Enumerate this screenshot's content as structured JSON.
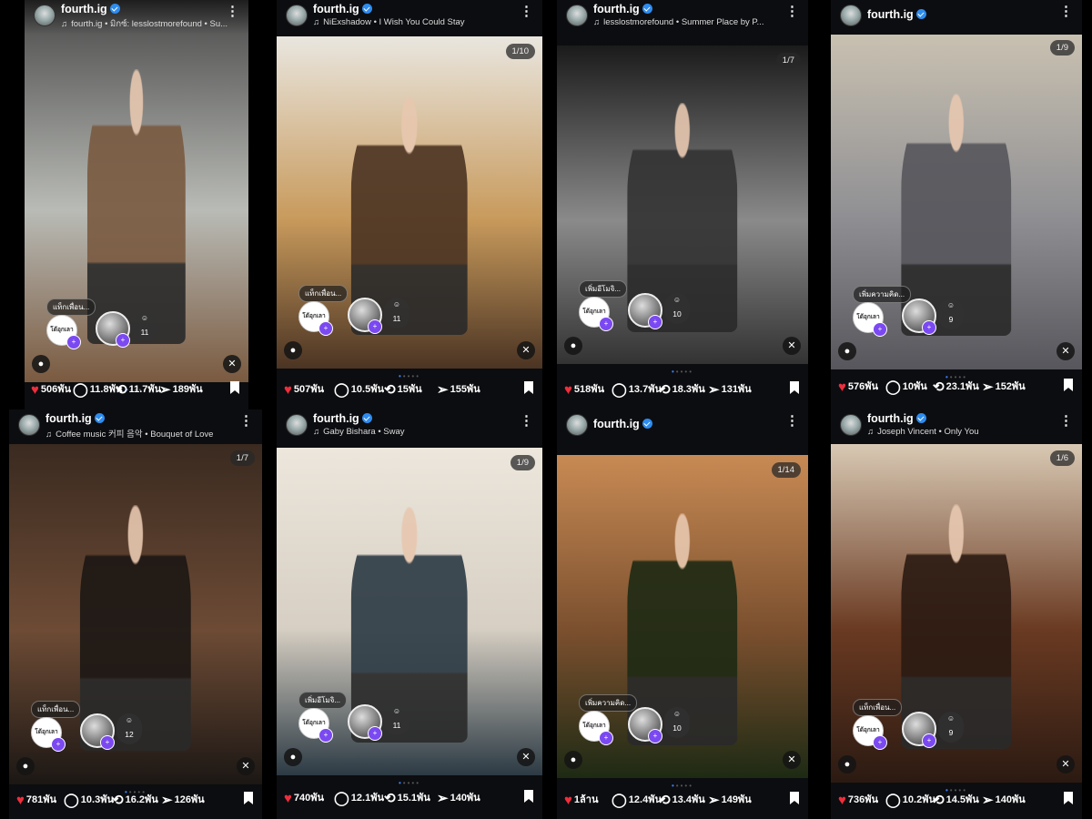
{
  "posts": [
    {
      "username": "fourth.ig",
      "music": "fourth.ig • มิกซ์: lesslostmorefound • Su...",
      "counter": "",
      "tag_bubble": "แท็กเพื่อน...",
      "tag_logo": "โด้อุกเลา",
      "tag_count": "11",
      "likes": "506พัน",
      "comments": "11.8พัน",
      "reposts": "11.7พัน",
      "shares": "189พัน",
      "photo_colors": [
        "#4a4a4a",
        "#b9bbb6",
        "#7a5a40"
      ]
    },
    {
      "username": "fourth.ig",
      "music": "NiExshadow • I Wish You Could Stay",
      "counter": "1/10",
      "tag_bubble": "แท็กเพื่อน...",
      "tag_logo": "โด้อุกเลา",
      "tag_count": "11",
      "likes": "507พัน",
      "comments": "10.5พัน",
      "reposts": "15พัน",
      "shares": "155พัน",
      "photo_colors": [
        "#e9e6df",
        "#c89a5c",
        "#4b3423"
      ]
    },
    {
      "username": "fourth.ig",
      "music": "lesslostmorefound • Summer Place by P...",
      "counter": "1/7",
      "tag_bubble": "เพิ่มอีโมจิ...",
      "tag_logo": "โด้อุกเลา",
      "tag_count": "10",
      "likes": "518พัน",
      "comments": "13.7พัน",
      "reposts": "18.3พัน",
      "shares": "131พัน",
      "photo_colors": [
        "#1b1b1b",
        "#8a8a8a",
        "#333333"
      ]
    },
    {
      "username": "fourth.ig",
      "music": "",
      "counter": "1/9",
      "tag_bubble": "เพิ่มความคิด...",
      "tag_logo": "โด้อุกเลา",
      "tag_count": "9",
      "likes": "576พัน",
      "comments": "10พัน",
      "reposts": "23.1พัน",
      "shares": "152พัน",
      "photo_colors": [
        "#c9c1b1",
        "#8f8f93",
        "#56565c"
      ]
    },
    {
      "username": "fourth.ig",
      "music": "Coffee music 커피 음악 • Bouquet of Love",
      "counter": "1/7",
      "tag_bubble": "แท็กเพื่อน...",
      "tag_logo": "โด้อุกเลา",
      "tag_count": "12",
      "likes": "781พัน",
      "comments": "10.3พัน",
      "reposts": "16.2พัน",
      "shares": "126พัน",
      "photo_colors": [
        "#3a2a20",
        "#6d4b35",
        "#1c1714"
      ]
    },
    {
      "username": "fourth.ig",
      "music": "Gaby Bishara • Sway",
      "counter": "1/9",
      "tag_bubble": "เพิ่มอีโมจิ...",
      "tag_logo": "โด้อุกเลา",
      "tag_count": "11",
      "likes": "740พัน",
      "comments": "12.1พัน",
      "reposts": "15.1พัน",
      "shares": "140พัน",
      "photo_colors": [
        "#ece6dc",
        "#d7cfc3",
        "#2c3a44"
      ]
    },
    {
      "username": "fourth.ig",
      "music": "",
      "counter": "1/14",
      "tag_bubble": "เพิ่มความคิด...",
      "tag_logo": "โด้อุกเลา",
      "tag_count": "10",
      "likes": "1ล้าน",
      "comments": "12.4พัน",
      "reposts": "13.4พัน",
      "shares": "149พัน",
      "photo_colors": [
        "#c88a54",
        "#7a4f2e",
        "#1e2a14"
      ]
    },
    {
      "username": "fourth.ig",
      "music": "Joseph Vincent • Only You",
      "counter": "1/6",
      "tag_bubble": "แท็กเพื่อน...",
      "tag_logo": "โด้อุกเลา",
      "tag_count": "9",
      "likes": "736พัน",
      "comments": "10.2พัน",
      "reposts": "14.5พัน",
      "shares": "140พัน",
      "photo_colors": [
        "#d9c9b4",
        "#6a3a22",
        "#2b1a12"
      ]
    }
  ],
  "icons": {
    "music": "music-note-icon",
    "more": "more-vertical-icon",
    "like": "heart-icon",
    "comment": "comment-icon",
    "repost": "repost-icon",
    "share": "send-icon",
    "bookmark": "bookmark-icon",
    "mute": "mute-icon",
    "person": "person-icon"
  },
  "colors": {
    "like": "#ef2e3d",
    "dot_active": "#3d7bf2",
    "badge": "#7b49f2",
    "verified": "#2d8cf0"
  }
}
